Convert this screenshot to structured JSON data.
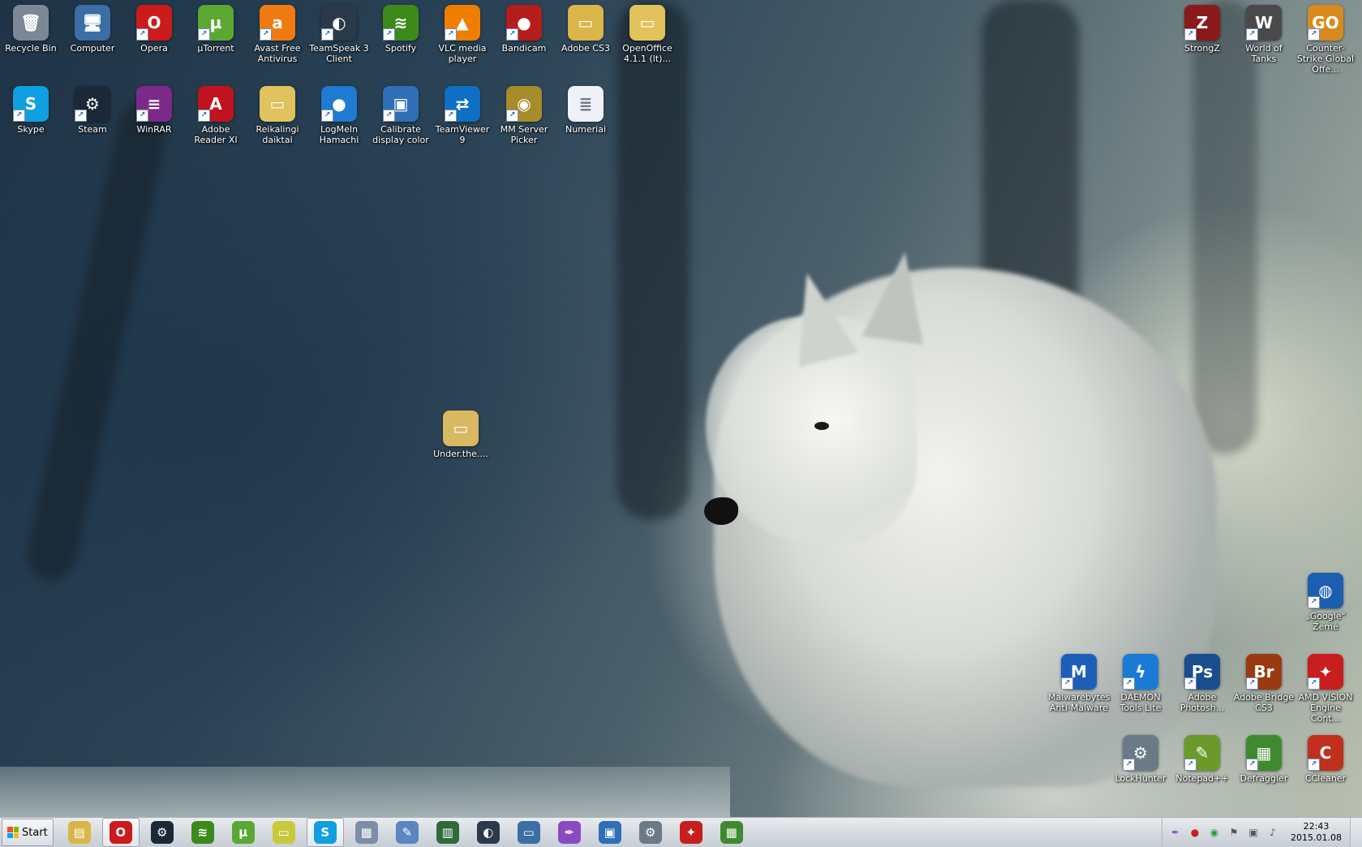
{
  "desktop": {
    "icons": [
      {
        "id": "recycle-bin",
        "label": "Recycle Bin",
        "glyph": "🗑",
        "color": "#7d8896",
        "shortcut": false
      },
      {
        "id": "computer",
        "label": "Computer",
        "glyph": "🖥",
        "color": "#3a6ea5",
        "shortcut": false
      },
      {
        "id": "opera",
        "label": "Opera",
        "glyph": "O",
        "color": "#cc1b1b",
        "shortcut": true
      },
      {
        "id": "utorrent",
        "label": "µTorrent",
        "glyph": "µ",
        "color": "#5aa832",
        "shortcut": true
      },
      {
        "id": "avast",
        "label": "Avast Free Antivirus",
        "glyph": "a",
        "color": "#f07a12",
        "shortcut": true
      },
      {
        "id": "teamspeak",
        "label": "TeamSpeak 3 Client",
        "glyph": "◐",
        "color": "#2b3a4a",
        "shortcut": true
      },
      {
        "id": "spotify",
        "label": "Spotify",
        "glyph": "≋",
        "color": "#3b8a1a",
        "shortcut": true
      },
      {
        "id": "vlc",
        "label": "VLC media player",
        "glyph": "▲",
        "color": "#ef7d00",
        "shortcut": true
      },
      {
        "id": "bandicam",
        "label": "Bandicam",
        "glyph": "●",
        "color": "#b51c1c",
        "shortcut": true
      },
      {
        "id": "adobe-cs3",
        "label": "Adobe CS3",
        "glyph": "▭",
        "color": "#d9b54a",
        "shortcut": false
      },
      {
        "id": "openoffice",
        "label": "OpenOffice 4.1.1 (lt)...",
        "glyph": "▭",
        "color": "#e2c25a",
        "shortcut": false
      },
      {
        "id": "skype",
        "label": "Skype",
        "glyph": "S",
        "color": "#109fe0",
        "shortcut": true
      },
      {
        "id": "steam",
        "label": "Steam",
        "glyph": "⚙",
        "color": "#1b2838",
        "shortcut": true
      },
      {
        "id": "winrar",
        "label": "WinRAR",
        "glyph": "≡",
        "color": "#7b2a8a",
        "shortcut": true
      },
      {
        "id": "adobe-reader",
        "label": "Adobe Reader XI",
        "glyph": "A",
        "color": "#c1121f",
        "shortcut": true
      },
      {
        "id": "reikalingi",
        "label": "Reikalingi daiktai",
        "glyph": "▭",
        "color": "#e0c25e",
        "shortcut": false
      },
      {
        "id": "hamachi",
        "label": "LogMeIn Hamachi",
        "glyph": "●",
        "color": "#1f7ad1",
        "shortcut": true
      },
      {
        "id": "calibrate",
        "label": "Calibrate display color",
        "glyph": "▣",
        "color": "#2f6fb7",
        "shortcut": true
      },
      {
        "id": "teamviewer",
        "label": "TeamViewer 9",
        "glyph": "⇄",
        "color": "#0e6fc4",
        "shortcut": true
      },
      {
        "id": "mm-server",
        "label": "MM Server Picker",
        "glyph": "◉",
        "color": "#a88b2a",
        "shortcut": true
      },
      {
        "id": "numeriai",
        "label": "Numeriai",
        "glyph": "≣",
        "color": "#eef2f6",
        "shortcut": false
      },
      {
        "id": "under-the",
        "label": "Under.the....",
        "glyph": "▭",
        "color": "#d9b862",
        "shortcut": false
      },
      {
        "id": "strongz",
        "label": "StrongZ",
        "glyph": "Z",
        "color": "#8a1a1a",
        "shortcut": true
      },
      {
        "id": "world-of-tanks",
        "label": "World of Tanks",
        "glyph": "W",
        "color": "#4a4a4a",
        "shortcut": true
      },
      {
        "id": "csgo",
        "label": "Counter-Strike Global Offe...",
        "glyph": "GO",
        "color": "#d88a1e",
        "shortcut": true
      },
      {
        "id": "google-earth",
        "label": "„Google\" Žemė",
        "glyph": "◍",
        "color": "#1c5fb0",
        "shortcut": true
      },
      {
        "id": "malwarebytes",
        "label": "Malwarebytes Anti-Malware",
        "glyph": "M",
        "color": "#1d5fb8",
        "shortcut": true
      },
      {
        "id": "daemon-tools",
        "label": "DAEMON Tools Lite",
        "glyph": "ϟ",
        "color": "#1a7bd6",
        "shortcut": true
      },
      {
        "id": "photoshop",
        "label": "Adobe Photosh...",
        "glyph": "Ps",
        "color": "#1a4d8f",
        "shortcut": true
      },
      {
        "id": "adobe-bridge",
        "label": "Adobe Bridge CS3",
        "glyph": "Br",
        "color": "#9a3a12",
        "shortcut": true
      },
      {
        "id": "amd-vision",
        "label": "AMD VISION Engine Cont...",
        "glyph": "✦",
        "color": "#c81e1e",
        "shortcut": true
      },
      {
        "id": "lockhunter",
        "label": "LockHunter",
        "glyph": "⚙",
        "color": "#6b7a86",
        "shortcut": true
      },
      {
        "id": "notepad-plus",
        "label": "Notepad++",
        "glyph": "✎",
        "color": "#6a9a2a",
        "shortcut": true
      },
      {
        "id": "defraggler",
        "label": "Defraggler",
        "glyph": "▦",
        "color": "#3f8a2e",
        "shortcut": true
      },
      {
        "id": "ccleaner",
        "label": "CCleaner",
        "glyph": "C",
        "color": "#c0301c",
        "shortcut": true
      }
    ]
  },
  "taskbar": {
    "start_label": "Start",
    "pinned": [
      {
        "id": "explorer",
        "glyph": "▤",
        "color": "#d9b54a",
        "active": false
      },
      {
        "id": "opera",
        "glyph": "O",
        "color": "#cc1b1b",
        "active": true
      },
      {
        "id": "steam",
        "glyph": "⚙",
        "color": "#1b2838",
        "active": false
      },
      {
        "id": "spotify",
        "glyph": "≋",
        "color": "#3b8a1a",
        "active": false
      },
      {
        "id": "utorrent",
        "glyph": "µ",
        "color": "#5aa832",
        "active": false
      },
      {
        "id": "sticky",
        "glyph": "▭",
        "color": "#c9c83a",
        "active": false
      },
      {
        "id": "skype",
        "glyph": "S",
        "color": "#109fe0",
        "active": true
      },
      {
        "id": "calculator",
        "glyph": "▦",
        "color": "#7b8ea6",
        "active": false
      },
      {
        "id": "paint",
        "glyph": "✎",
        "color": "#5a86c2",
        "active": false
      },
      {
        "id": "task-manager",
        "glyph": "▥",
        "color": "#2f6a3a",
        "active": false
      },
      {
        "id": "teamspeak",
        "glyph": "◐",
        "color": "#2b3a4a",
        "active": false
      },
      {
        "id": "remote-desktop",
        "glyph": "▭",
        "color": "#3a6ea5",
        "active": false
      },
      {
        "id": "feather",
        "glyph": "✒",
        "color": "#8a4ac2",
        "active": false
      },
      {
        "id": "display",
        "glyph": "▣",
        "color": "#2f6fb7",
        "active": false
      },
      {
        "id": "settings",
        "glyph": "⚙",
        "color": "#6b7a86",
        "active": false
      },
      {
        "id": "amd",
        "glyph": "✦",
        "color": "#c81e1e",
        "active": false
      },
      {
        "id": "windows-update",
        "glyph": "▦",
        "color": "#3f8a2e",
        "active": false
      }
    ],
    "tray": [
      {
        "id": "pen",
        "glyph": "✒",
        "color": "#8a4ac2"
      },
      {
        "id": "lips",
        "glyph": "●",
        "color": "#c81e1e"
      },
      {
        "id": "chrome",
        "glyph": "◉",
        "color": "#2a9a3a"
      },
      {
        "id": "flag",
        "glyph": "⚑",
        "color": "#555555"
      },
      {
        "id": "network",
        "glyph": "▣",
        "color": "#555555"
      },
      {
        "id": "volume",
        "glyph": "♪",
        "color": "#555555"
      }
    ],
    "clock": {
      "time": "22:43",
      "date": "2015.01.08"
    }
  }
}
